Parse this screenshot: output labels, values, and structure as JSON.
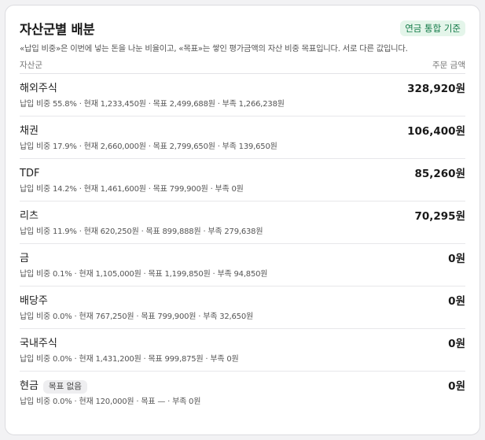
{
  "card": {
    "title": "자산군별 배분",
    "badge": "연금 통합 기준",
    "description": "«납입 비중»은 이번에 넣는 돈을 나눈 비율이고, «목표»는 쌓인 평가금액의 자산 비중 목표입니다. 서로 다른 값입니다.",
    "column_left": "자산군",
    "column_right": "주문 금액"
  },
  "rows": [
    {
      "name": "해외주식",
      "tag": "",
      "amount": "328,920원",
      "detail": "납입 비중 55.8% · 현재 1,233,450원 · 목표 2,499,688원 · 부족 1,266,238원"
    },
    {
      "name": "채권",
      "tag": "",
      "amount": "106,400원",
      "detail": "납입 비중 17.9% · 현재 2,660,000원 · 목표 2,799,650원 · 부족 139,650원"
    },
    {
      "name": "TDF",
      "tag": "",
      "amount": "85,260원",
      "detail": "납입 비중 14.2% · 현재 1,461,600원 · 목표 799,900원 · 부족 0원"
    },
    {
      "name": "리츠",
      "tag": "",
      "amount": "70,295원",
      "detail": "납입 비중 11.9% · 현재 620,250원 · 목표 899,888원 · 부족 279,638원"
    },
    {
      "name": "금",
      "tag": "",
      "amount": "0원",
      "detail": "납입 비중 0.1% · 현재 1,105,000원 · 목표 1,199,850원 · 부족 94,850원"
    },
    {
      "name": "배당주",
      "tag": "",
      "amount": "0원",
      "detail": "납입 비중 0.0% · 현재 767,250원 · 목표 799,900원 · 부족 32,650원"
    },
    {
      "name": "국내주식",
      "tag": "",
      "amount": "0원",
      "detail": "납입 비중 0.0% · 현재 1,431,200원 · 목표 999,875원 · 부족 0원"
    },
    {
      "name": "현금",
      "tag": "목표 없음",
      "amount": "0원",
      "detail": "납입 비중 0.0% · 현재 120,000원 · 목표 — · 부족 0원"
    }
  ]
}
